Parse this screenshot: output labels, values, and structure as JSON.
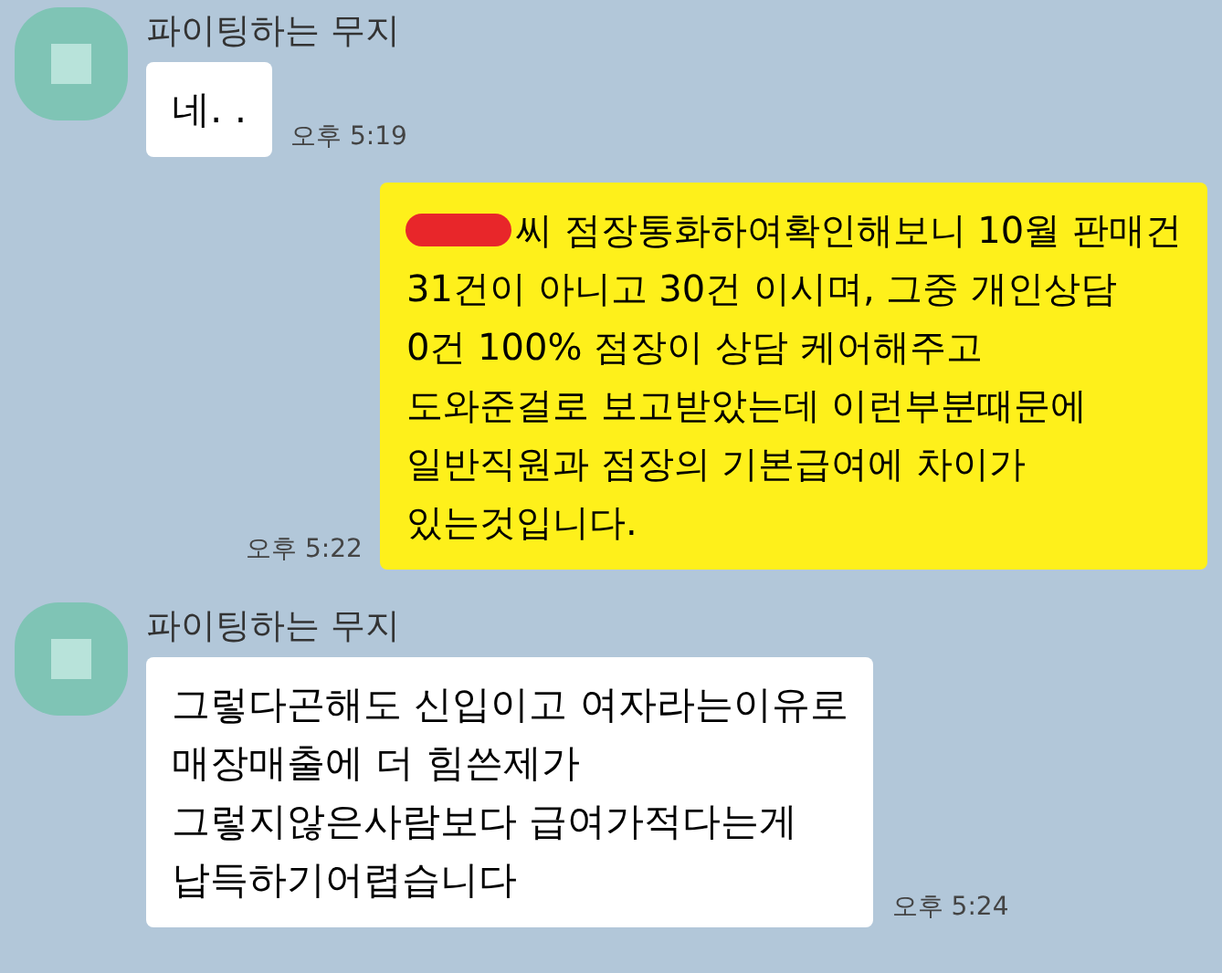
{
  "messages": [
    {
      "kind": "received",
      "sender": "파이팅하는 무지",
      "lines": [
        "네. ."
      ],
      "time": "오후 5:19"
    },
    {
      "kind": "sent",
      "redacted": true,
      "lines": [
        "씨 점장통화하여확인해보니 10월 판매건",
        "31건이 아니고 30건 이시며, 그중 개인상담",
        "0건 100% 점장이 상담 케어해주고",
        "도와준걸로 보고받았는데 이런부분때문에",
        "일반직원과 점장의 기본급여에 차이가",
        "있는것입니다."
      ],
      "time": "오후 5:22"
    },
    {
      "kind": "received",
      "sender": "파이팅하는 무지",
      "lines": [
        "그렇다곤해도 신입이고 여자라는이유로",
        "매장매출에 더 힘쓴제가",
        "그렇지않은사람보다 급여가적다는게",
        "납득하기어렵습니다"
      ],
      "time": "오후 5:24"
    }
  ]
}
